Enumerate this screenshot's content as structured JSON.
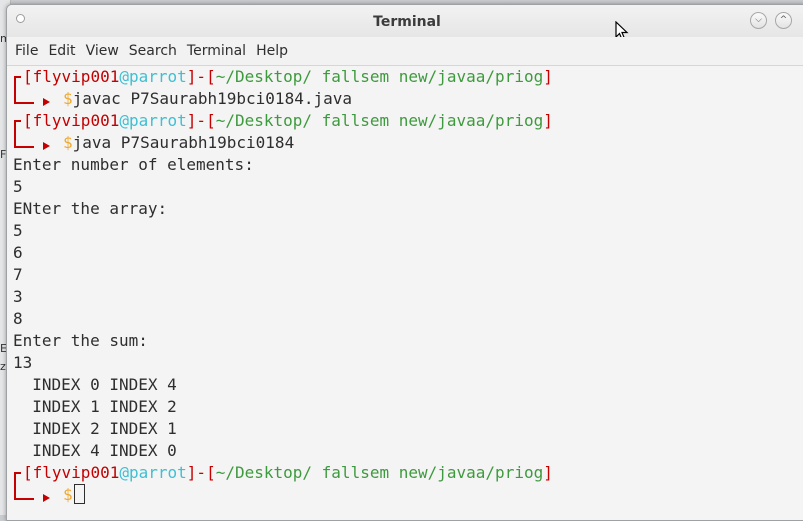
{
  "window": {
    "title": "Terminal"
  },
  "menu": [
    "File",
    "Edit",
    "View",
    "Search",
    "Terminal",
    "Help"
  ],
  "background_window_fragments": [
    "m",
    "F",
    "E",
    "z"
  ],
  "prompt": {
    "user": "flyvip001",
    "at": "@",
    "host": "parrot",
    "dash": "-",
    "path": "~/Desktop/ fallsem new/javaa/priog",
    "symbol": "$"
  },
  "commands": [
    "javac P7Saurabh19bci0184.java",
    "java P7Saurabh19bci0184"
  ],
  "output": [
    "Enter number of elements:",
    "5",
    "ENter the array:",
    "5",
    "6",
    "7",
    "3",
    "8",
    "Enter the sum:",
    "13",
    "  INDEX 0 INDEX 4",
    "  INDEX 1 INDEX 2",
    "  INDEX 2 INDEX 1",
    "  INDEX 4 INDEX 0"
  ],
  "colors": {
    "prompt_frame": "#c40000",
    "user": "#c40000",
    "host": "#3fbfd2",
    "path": "#3e9a3e",
    "dollar": "#f0a930",
    "text": "#2e2e2e"
  }
}
